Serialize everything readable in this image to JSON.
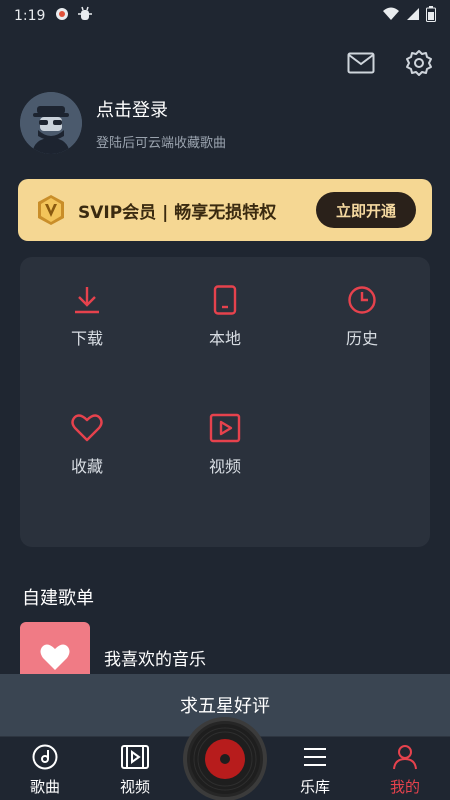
{
  "status_bar": {
    "time": "1:19"
  },
  "profile": {
    "login_title": "点击登录",
    "login_subtitle": "登陆后可云端收藏歌曲"
  },
  "vip": {
    "text": "SVIP会员 | 畅享无损特权",
    "button_label": "立即开通"
  },
  "features": [
    {
      "label": "下载",
      "icon": "download-icon"
    },
    {
      "label": "本地",
      "icon": "phone-icon"
    },
    {
      "label": "历史",
      "icon": "clock-icon"
    },
    {
      "label": "收藏",
      "icon": "heart-icon"
    },
    {
      "label": "视频",
      "icon": "play-icon"
    }
  ],
  "section": {
    "title": "自建歌单"
  },
  "playlists": [
    {
      "name": "我喜欢的音乐"
    }
  ],
  "rate_bar": {
    "label": "求五星好评"
  },
  "tabs": [
    {
      "label": "歌曲",
      "icon": "music-disc-icon",
      "active": false
    },
    {
      "label": "视频",
      "icon": "video-icon",
      "active": false
    },
    {
      "label": "乐库",
      "icon": "menu-icon",
      "active": false
    },
    {
      "label": "我的",
      "icon": "user-icon",
      "active": true
    }
  ],
  "colors": {
    "background": "#1f2631",
    "accent_red": "#e6424d",
    "vip_gold": "#f5d793",
    "card": "#2a313c"
  }
}
